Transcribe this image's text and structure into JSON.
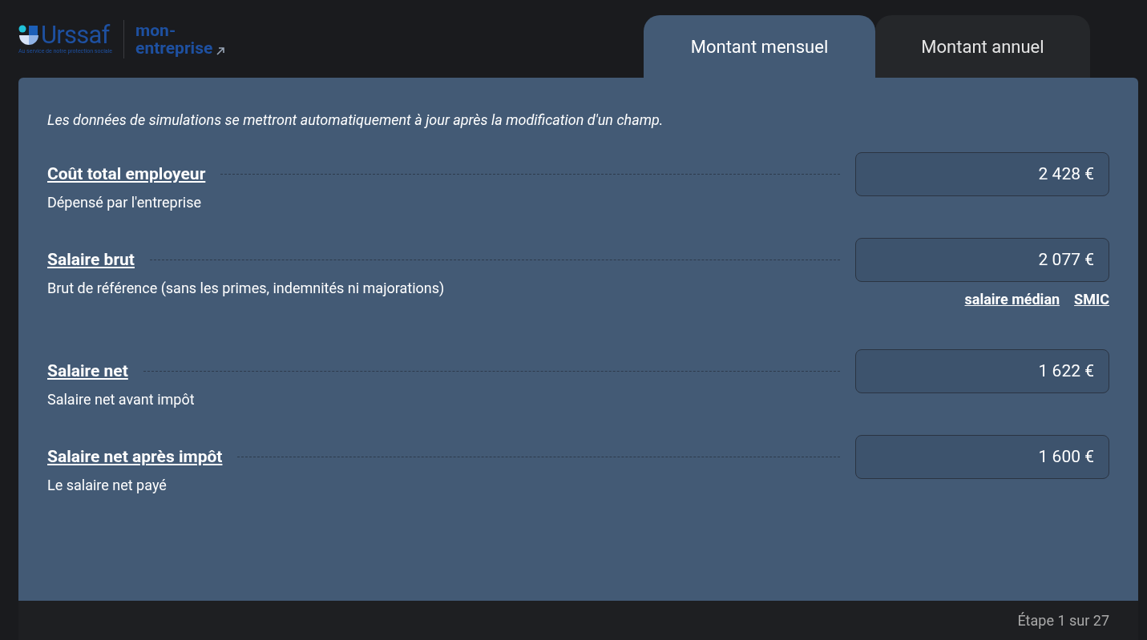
{
  "logo": {
    "brand": "Urssaf",
    "tagline": "Au service de notre protection sociale",
    "product_line1": "mon-",
    "product_line2": "entreprise"
  },
  "tabs": [
    {
      "label": "Montant mensuel",
      "selected": true
    },
    {
      "label": "Montant annuel",
      "selected": false
    }
  ],
  "notice": "Les données de simulations se mettront automatiquement à jour après la modification d'un champ.",
  "fields": [
    {
      "label": "Coût total employeur",
      "value": "2 428 €",
      "description": "Dépensé par l'entreprise"
    },
    {
      "label": "Salaire brut",
      "value": "2 077 €",
      "description": "Brut de référence (sans les primes, indemnités ni majorations)",
      "shortcuts": [
        "salaire médian",
        "SMIC"
      ]
    },
    {
      "label": "Salaire net",
      "value": "1 622 €",
      "description": "Salaire net avant impôt"
    },
    {
      "label": "Salaire net après impôt",
      "value": "1 600 €",
      "description": "Le salaire net payé"
    }
  ],
  "footer": "Étape 1 sur 27"
}
